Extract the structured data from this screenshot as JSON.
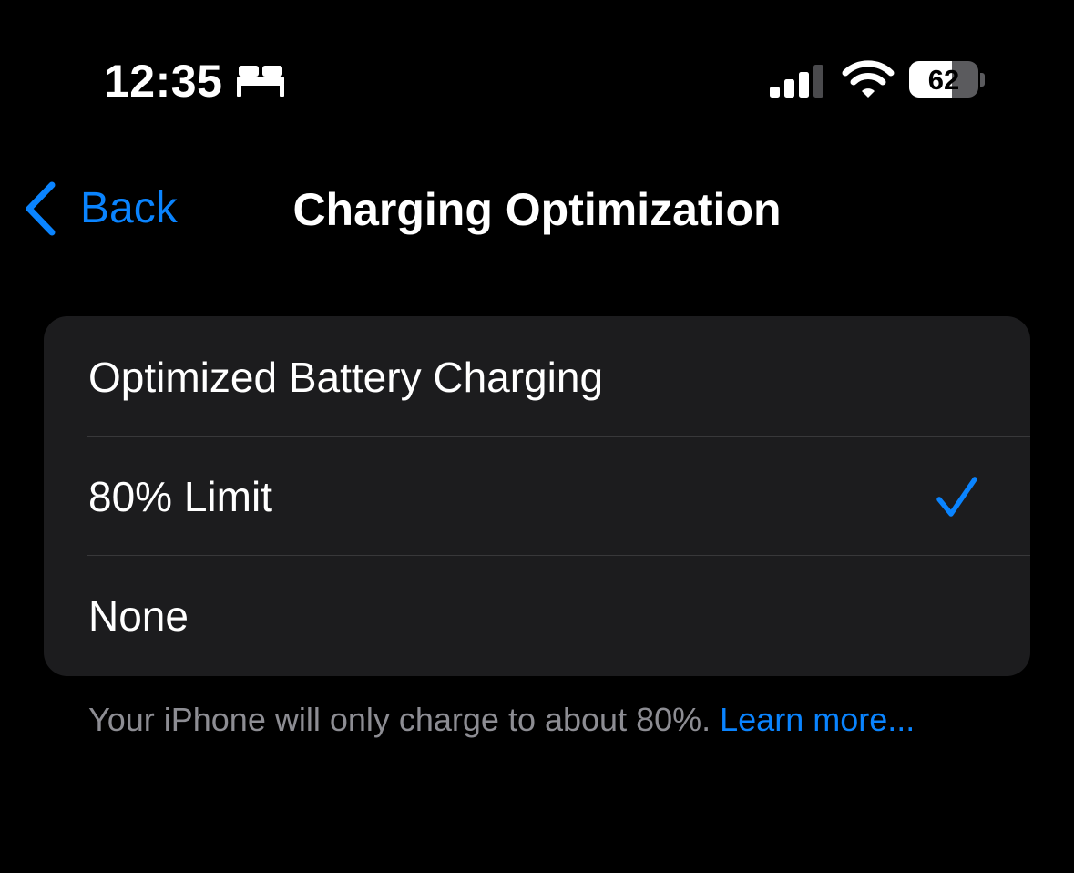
{
  "status_bar": {
    "time": "12:35",
    "focus_icon": "bed-icon",
    "signal_icon": "cellular-signal-icon",
    "signal_bars_active": 3,
    "signal_bars_total": 4,
    "wifi_icon": "wifi-icon",
    "battery_percent": "62",
    "battery_level": 0.62
  },
  "nav": {
    "back_label": "Back",
    "title": "Charging Optimization"
  },
  "options": [
    {
      "label": "Optimized Battery Charging",
      "selected": false
    },
    {
      "label": "80% Limit",
      "selected": true
    },
    {
      "label": "None",
      "selected": false
    }
  ],
  "footer": {
    "text": "Your iPhone will only charge to about 80%.",
    "link": "Learn more..."
  },
  "colors": {
    "accent": "#0a84ff",
    "background": "#000000",
    "card": "#1c1c1e",
    "separator": "#38383a",
    "secondary_text": "#8d8d93"
  }
}
